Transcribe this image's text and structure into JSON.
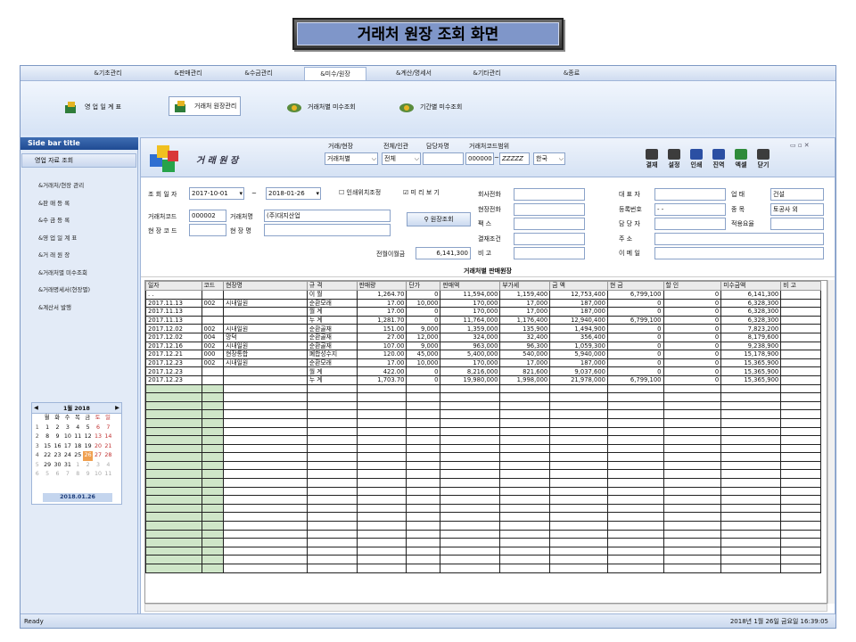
{
  "slide_title": "거래처 원장 조회 화면",
  "menu": [
    "&기초관리",
    "&판매관리",
    "&수금관리",
    "&미수/원장",
    "&계산/명세서",
    "&기타관리",
    "&종료"
  ],
  "menu_active": 3,
  "ribbon": [
    "영 업 일 계 표",
    "거래처 원장관리",
    "거래처별 미수조회",
    "기간별 미수조회"
  ],
  "sidebar": {
    "title": "Side bar title",
    "header": "영업 자료 조회",
    "items": [
      "&거래처/현장 관리",
      "&판 매 등 록",
      "&수 금 등 록",
      "&영 업 일 계 표",
      "&거 래 원 장",
      "&거래처별 미수조회",
      "&거래명세서(현장별)",
      "&계산서 발행"
    ]
  },
  "calendar": {
    "title": "1월 2018",
    "dow": [
      "월",
      "화",
      "수",
      "목",
      "금",
      "토",
      "일"
    ],
    "weeks": [
      [
        "1",
        "1",
        "2",
        "3",
        "4",
        "5",
        "6",
        "7"
      ],
      [
        "2",
        "8",
        "9",
        "10",
        "11",
        "12",
        "13",
        "14"
      ],
      [
        "3",
        "15",
        "16",
        "17",
        "18",
        "19",
        "20",
        "21"
      ],
      [
        "4",
        "22",
        "23",
        "24",
        "25",
        "26",
        "27",
        "28"
      ],
      [
        "5",
        "29",
        "30",
        "31",
        "1",
        "2",
        "3",
        "4"
      ],
      [
        "6",
        "5",
        "6",
        "7",
        "8",
        "9",
        "10",
        "11"
      ]
    ],
    "today": "2018.01.26"
  },
  "header": {
    "title": "거 래 원 장",
    "f1_label": "거래/현장",
    "f1_val": "거래처별",
    "f2_label": "전체/인관",
    "f2_val": "전체",
    "f3_label": "담당자명",
    "f4_label": "거래처코드범위",
    "f4_from": "000000",
    "f4_to": "ZZZZZ",
    "lang": "한국",
    "buttons": [
      "결재",
      "설정",
      "인쇄",
      "진역",
      "엑셀",
      "닫기"
    ]
  },
  "form": {
    "date_label": "조 회 일 자",
    "date_from": "2017-10-01",
    "date_to": "2018-01-26",
    "chk1": "인쇄위치조정",
    "chk2": "미 리 보 기",
    "code_label": "거래처코드",
    "code_val": "000002",
    "name_label": "거래처명",
    "name_val": "(주)대지산업",
    "site_code_label": "현 장 코 드",
    "site_name_label": "현 장 명",
    "btn": "원장조회",
    "prev_label": "전월이월금",
    "prev_val": "6,141,300",
    "right1": [
      "회사전화",
      "현장전화",
      "팩      스",
      "결재조건",
      "비      고"
    ],
    "right2": [
      "대 표 자",
      "등록번호",
      "담 당 자",
      "주      소",
      "이 메 일"
    ],
    "reg_val": "-  -",
    "right3": [
      "업      태",
      "종      목",
      "적용요율"
    ],
    "biz_type": "건설",
    "biz_item": "토공사 외"
  },
  "grid": {
    "title": "거래처별 판매원장",
    "columns": [
      "일자",
      "코드",
      "현장명",
      "규 격",
      "판매량",
      "단가",
      "판매액",
      "부가세",
      "금    액",
      "현    금",
      "할    인",
      "미수금액",
      "비 고"
    ],
    "rows": [
      [
        ". .",
        "",
        "",
        "이   월",
        "1,264.70",
        "0",
        "11,594,000",
        "1,159,400",
        "12,753,400",
        "6,799,100",
        "0",
        "6,141,300",
        ""
      ],
      [
        "2017.11.13",
        "002",
        "시내일원",
        "순환모래",
        "17.00",
        "10,000",
        "170,000",
        "17,000",
        "187,000",
        "0",
        "0",
        "6,328,300",
        ""
      ],
      [
        "2017.11.13",
        "",
        "",
        "월   계",
        "17.00",
        "0",
        "170,000",
        "17,000",
        "187,000",
        "0",
        "0",
        "6,328,300",
        ""
      ],
      [
        "2017.11.13",
        "",
        "",
        "누   계",
        "1,281.70",
        "0",
        "11,764,000",
        "1,176,400",
        "12,940,400",
        "6,799,100",
        "0",
        "6,328,300",
        ""
      ],
      [
        "2017.12.02",
        "002",
        "시내일원",
        "순환골재",
        "151.00",
        "9,000",
        "1,359,000",
        "135,900",
        "1,494,900",
        "0",
        "0",
        "7,823,200",
        ""
      ],
      [
        "2017.12.02",
        "004",
        "망덕",
        "순환골재",
        "27.00",
        "12,000",
        "324,000",
        "32,400",
        "356,400",
        "0",
        "0",
        "8,179,600",
        ""
      ],
      [
        "2017.12.16",
        "002",
        "시내일원",
        "순환골재",
        "107.00",
        "9,000",
        "963,000",
        "96,300",
        "1,059,300",
        "0",
        "0",
        "9,238,900",
        ""
      ],
      [
        "2017.12.21",
        "000",
        "현장통합",
        "폐합성수지",
        "120.00",
        "45,000",
        "5,400,000",
        "540,000",
        "5,940,000",
        "0",
        "0",
        "15,178,900",
        ""
      ],
      [
        "2017.12.23",
        "002",
        "시내일원",
        "순환모래",
        "17.00",
        "10,000",
        "170,000",
        "17,000",
        "187,000",
        "0",
        "0",
        "15,365,900",
        ""
      ],
      [
        "2017.12.23",
        "",
        "",
        "월   계",
        "422.00",
        "0",
        "8,216,000",
        "821,600",
        "9,037,600",
        "0",
        "0",
        "15,365,900",
        ""
      ],
      [
        "2017.12.23",
        "",
        "",
        "누   계",
        "1,703.70",
        "0",
        "19,980,000",
        "1,998,000",
        "21,978,000",
        "6,799,100",
        "0",
        "15,365,900",
        ""
      ]
    ]
  },
  "status": {
    "left": "Ready",
    "right": "2018년 1월 26일 금요일 16:39:05"
  }
}
